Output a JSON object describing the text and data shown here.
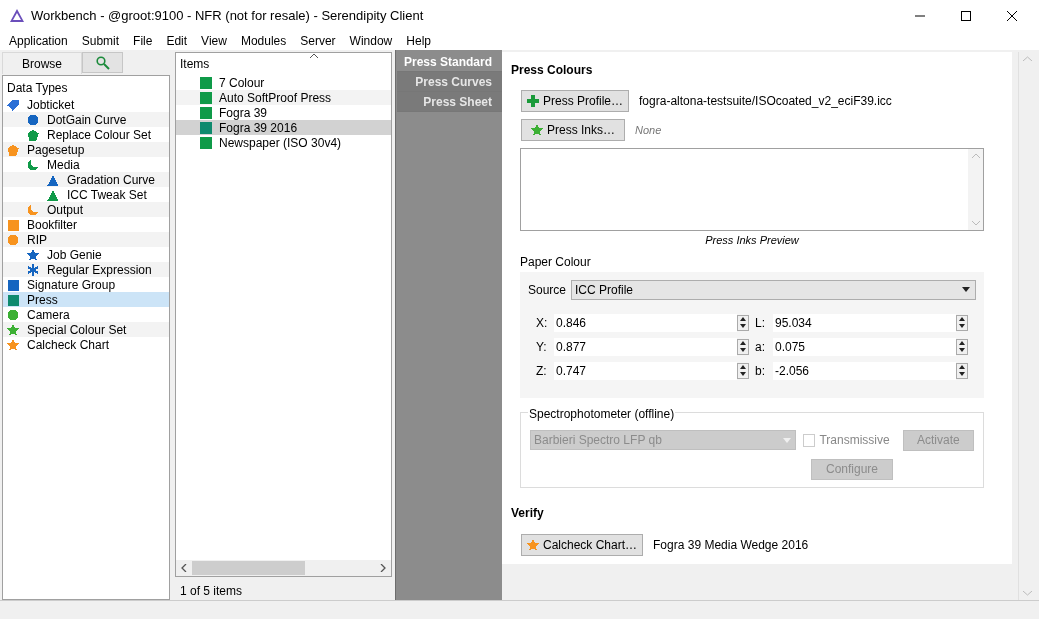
{
  "window": {
    "title": "Workbench - @groot:9100 - NFR (not for resale) - Serendipity Client"
  },
  "menu": [
    "Application",
    "Submit",
    "File",
    "Edit",
    "View",
    "Modules",
    "Server",
    "Window",
    "Help"
  ],
  "left_tabs": [
    {
      "kind": "text",
      "label": "Browse",
      "selected": true
    },
    {
      "kind": "search",
      "selected": false
    }
  ],
  "tree": {
    "title": "Data Types",
    "items": [
      {
        "label": "Jobticket",
        "kind": "tag",
        "color": "#2b6fd6",
        "selected": false,
        "children": [
          {
            "label": "DotGain Curve",
            "kind": "circle",
            "color": "#1565c0",
            "selected": false
          },
          {
            "label": "Replace Colour Set",
            "kind": "pentagon",
            "color": "#0f9a48",
            "selected": false
          }
        ]
      },
      {
        "label": "Pagesetup",
        "kind": "pentagon",
        "color": "#f7931e",
        "selected": false,
        "children": [
          {
            "label": "Media",
            "kind": "moon",
            "color": "#0f9a48",
            "selected": false,
            "children": [
              {
                "label": "Gradation Curve",
                "kind": "triangle",
                "color": "#1565c0",
                "selected": false
              },
              {
                "label": "ICC Tweak Set",
                "kind": "triangle",
                "color": "#0f9a48",
                "selected": false
              }
            ]
          },
          {
            "label": "Output",
            "kind": "moon",
            "color": "#f7931e",
            "selected": false
          }
        ]
      },
      {
        "label": "Bookfilter",
        "kind": "square",
        "color": "#f7931e",
        "selected": false
      },
      {
        "label": "RIP",
        "kind": "circle",
        "color": "#f7931e",
        "selected": false,
        "children": [
          {
            "label": "Job Genie",
            "kind": "star",
            "color": "#1565c0",
            "selected": false
          },
          {
            "label": "Regular Expression",
            "kind": "asterisk",
            "color": "#1565c0",
            "selected": false
          }
        ]
      },
      {
        "label": "Signature Group",
        "kind": "square",
        "color": "#1565c0",
        "selected": false
      },
      {
        "label": "Press",
        "kind": "square",
        "color": "#0e8a6e",
        "selected": true
      },
      {
        "label": "Camera",
        "kind": "circle",
        "color": "#3cb034",
        "selected": false
      },
      {
        "label": "Special Colour Set",
        "kind": "star",
        "color": "#3cb034",
        "selected": false
      },
      {
        "label": "Calcheck Chart",
        "kind": "star",
        "color": "#f7931e",
        "selected": false
      }
    ]
  },
  "items_list": {
    "header": "Items",
    "items": [
      {
        "label": "7 Colour",
        "selected": false
      },
      {
        "label": "Auto SoftProof Press",
        "selected": false
      },
      {
        "label": "Fogra 39",
        "selected": false
      },
      {
        "label": "Fogra 39 2016",
        "selected": true
      },
      {
        "label": "Newspaper (ISO 30v4)",
        "selected": false
      }
    ],
    "status": "1 of 5 items"
  },
  "side_tabs": [
    {
      "label": "Press Standard",
      "selected": true
    },
    {
      "label": "Press Curves",
      "selected": false
    },
    {
      "label": "Press Sheet",
      "selected": false
    }
  ],
  "press_colours": {
    "title": "Press Colours",
    "profile_button": "Press Profile…",
    "profile": "fogra-altona-testsuite/ISOcoated_v2_eciF39.icc",
    "inks_button": "Press Inks…",
    "inks": "None",
    "preview_caption": "Press Inks Preview"
  },
  "paper_colour": {
    "title": "Paper Colour",
    "source_label": "Source",
    "source": "ICC Profile",
    "fields": [
      {
        "label": "X:",
        "value": "0.846"
      },
      {
        "label": "L:",
        "value": "95.034"
      },
      {
        "label": "Y:",
        "value": "0.877"
      },
      {
        "label": "a:",
        "value": "0.075"
      },
      {
        "label": "Z:",
        "value": "0.747"
      },
      {
        "label": "b:",
        "value": "-2.056"
      }
    ]
  },
  "spectro": {
    "title": "Spectrophotometer (offline)",
    "device": "Barbieri Spectro LFP qb",
    "disabled": true,
    "transmissive": {
      "label": "Transmissive",
      "checked": false
    },
    "activate": "Activate",
    "configure": "Configure"
  },
  "verify": {
    "title": "Verify",
    "button": "Calcheck Chart…",
    "value": "Fogra 39 Media Wedge 2016"
  }
}
